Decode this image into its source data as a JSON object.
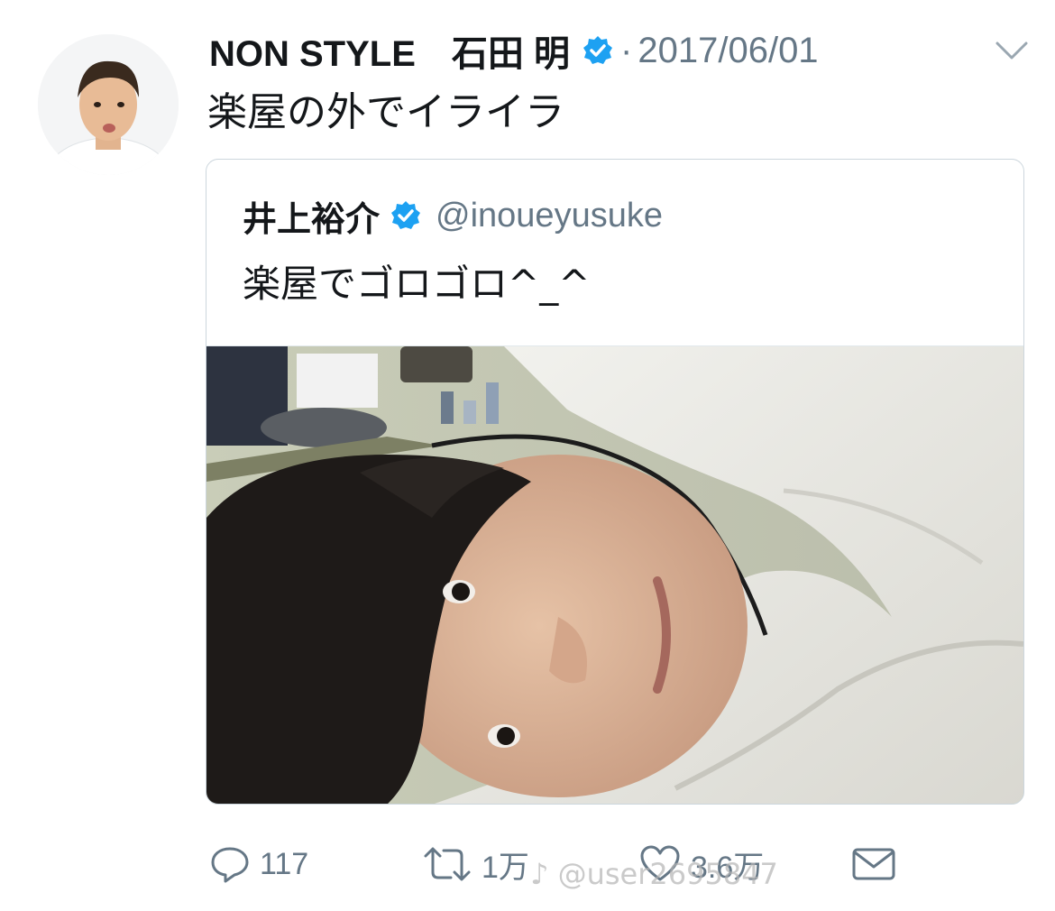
{
  "tweet": {
    "display_name": "NON STYLE　石田 明",
    "separator": "·",
    "date": "2017/06/01",
    "text": "楽屋の外でイライラ",
    "avatar_icon": "avatar-photo"
  },
  "quoted_tweet": {
    "display_name": "井上裕介",
    "handle": "@inoueyusuke",
    "text": "楽屋でゴロゴロ^_^",
    "photo_icon": "selfie-photo"
  },
  "actions": {
    "reply_count": "117",
    "retweet_count": "1万",
    "like_count": "3.6万"
  },
  "watermark": {
    "text": "@user2695847"
  },
  "colors": {
    "verified": "#1da1f2",
    "secondary_text": "#657786",
    "border": "#ccd6dd"
  }
}
